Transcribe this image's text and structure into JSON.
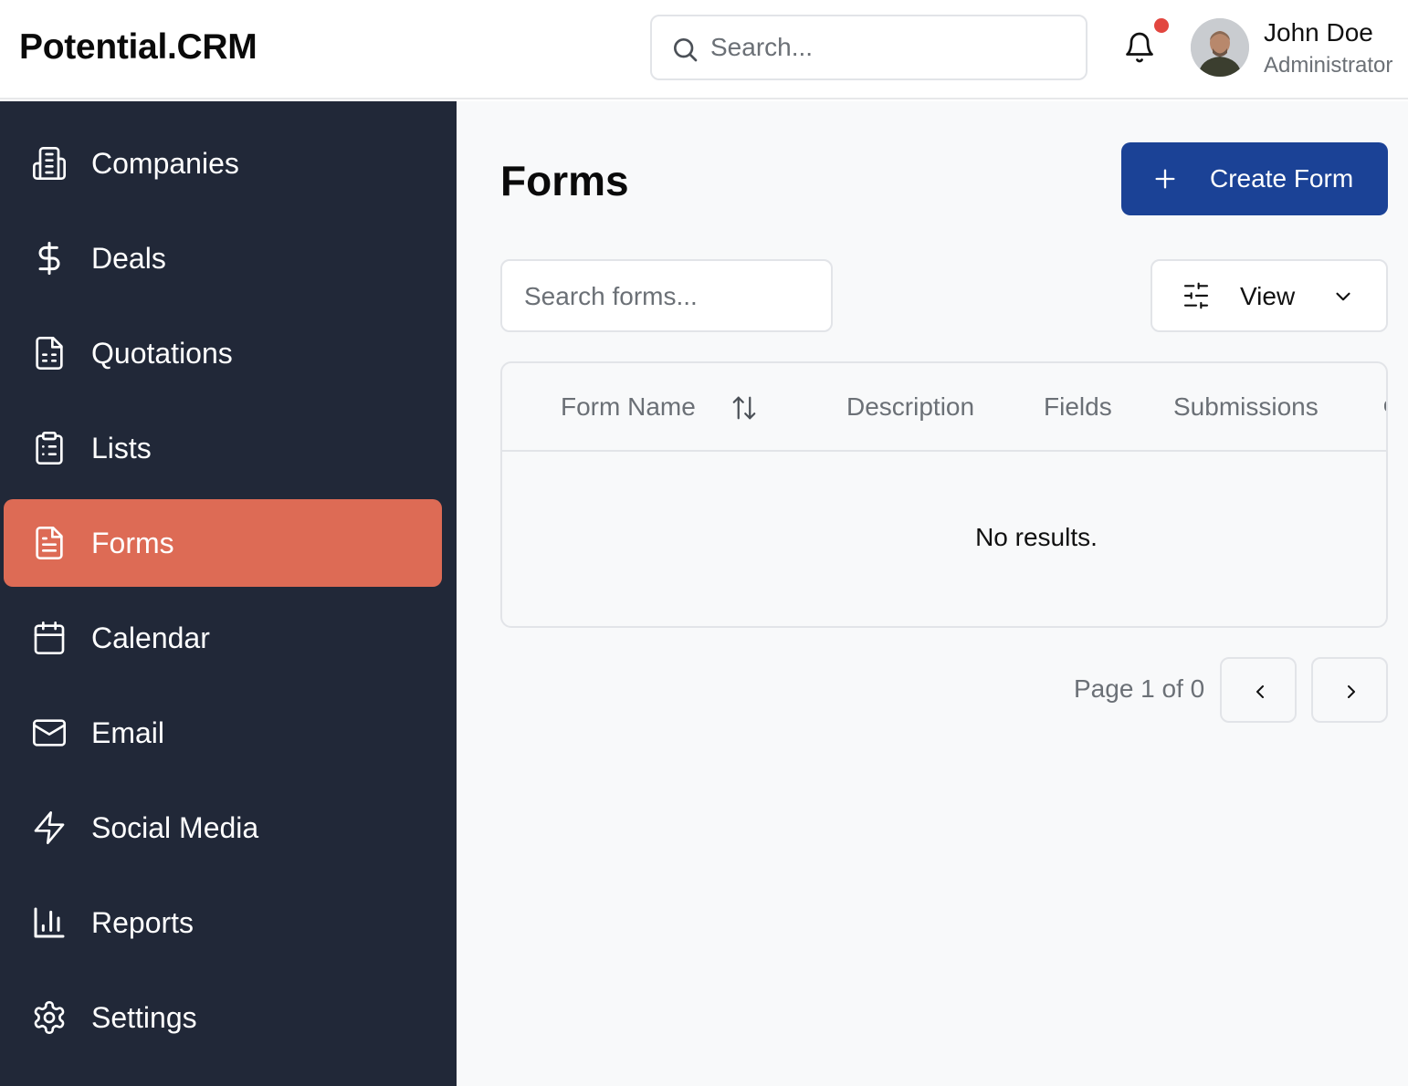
{
  "app": {
    "logo": "Potential.CRM"
  },
  "header": {
    "search_placeholder": "Search...",
    "user": {
      "name": "John Doe",
      "role": "Administrator"
    },
    "notification_dot_color": "#e2463f"
  },
  "sidebar": {
    "background": "#212838",
    "active_color": "#dd6b55",
    "items": [
      {
        "label": "Companies",
        "icon": "building-icon"
      },
      {
        "label": "Deals",
        "icon": "dollar-icon"
      },
      {
        "label": "Quotations",
        "icon": "file-spreadsheet-icon"
      },
      {
        "label": "Lists",
        "icon": "clipboard-list-icon"
      },
      {
        "label": "Forms",
        "icon": "file-text-icon",
        "active": true
      },
      {
        "label": "Calendar",
        "icon": "calendar-icon"
      },
      {
        "label": "Email",
        "icon": "mail-icon"
      },
      {
        "label": "Social Media",
        "icon": "zap-icon"
      },
      {
        "label": "Reports",
        "icon": "bar-chart-icon"
      },
      {
        "label": "Settings",
        "icon": "gear-icon"
      }
    ]
  },
  "main": {
    "title": "Forms",
    "create_button": "Create Form",
    "create_button_color": "#1b4296",
    "search_placeholder": "Search forms...",
    "view_button": "View",
    "table": {
      "columns": [
        "Form Name",
        "Description",
        "Fields",
        "Submissions"
      ],
      "empty_message": "No results."
    },
    "pagination": {
      "text": "Page 1 of 0"
    }
  }
}
